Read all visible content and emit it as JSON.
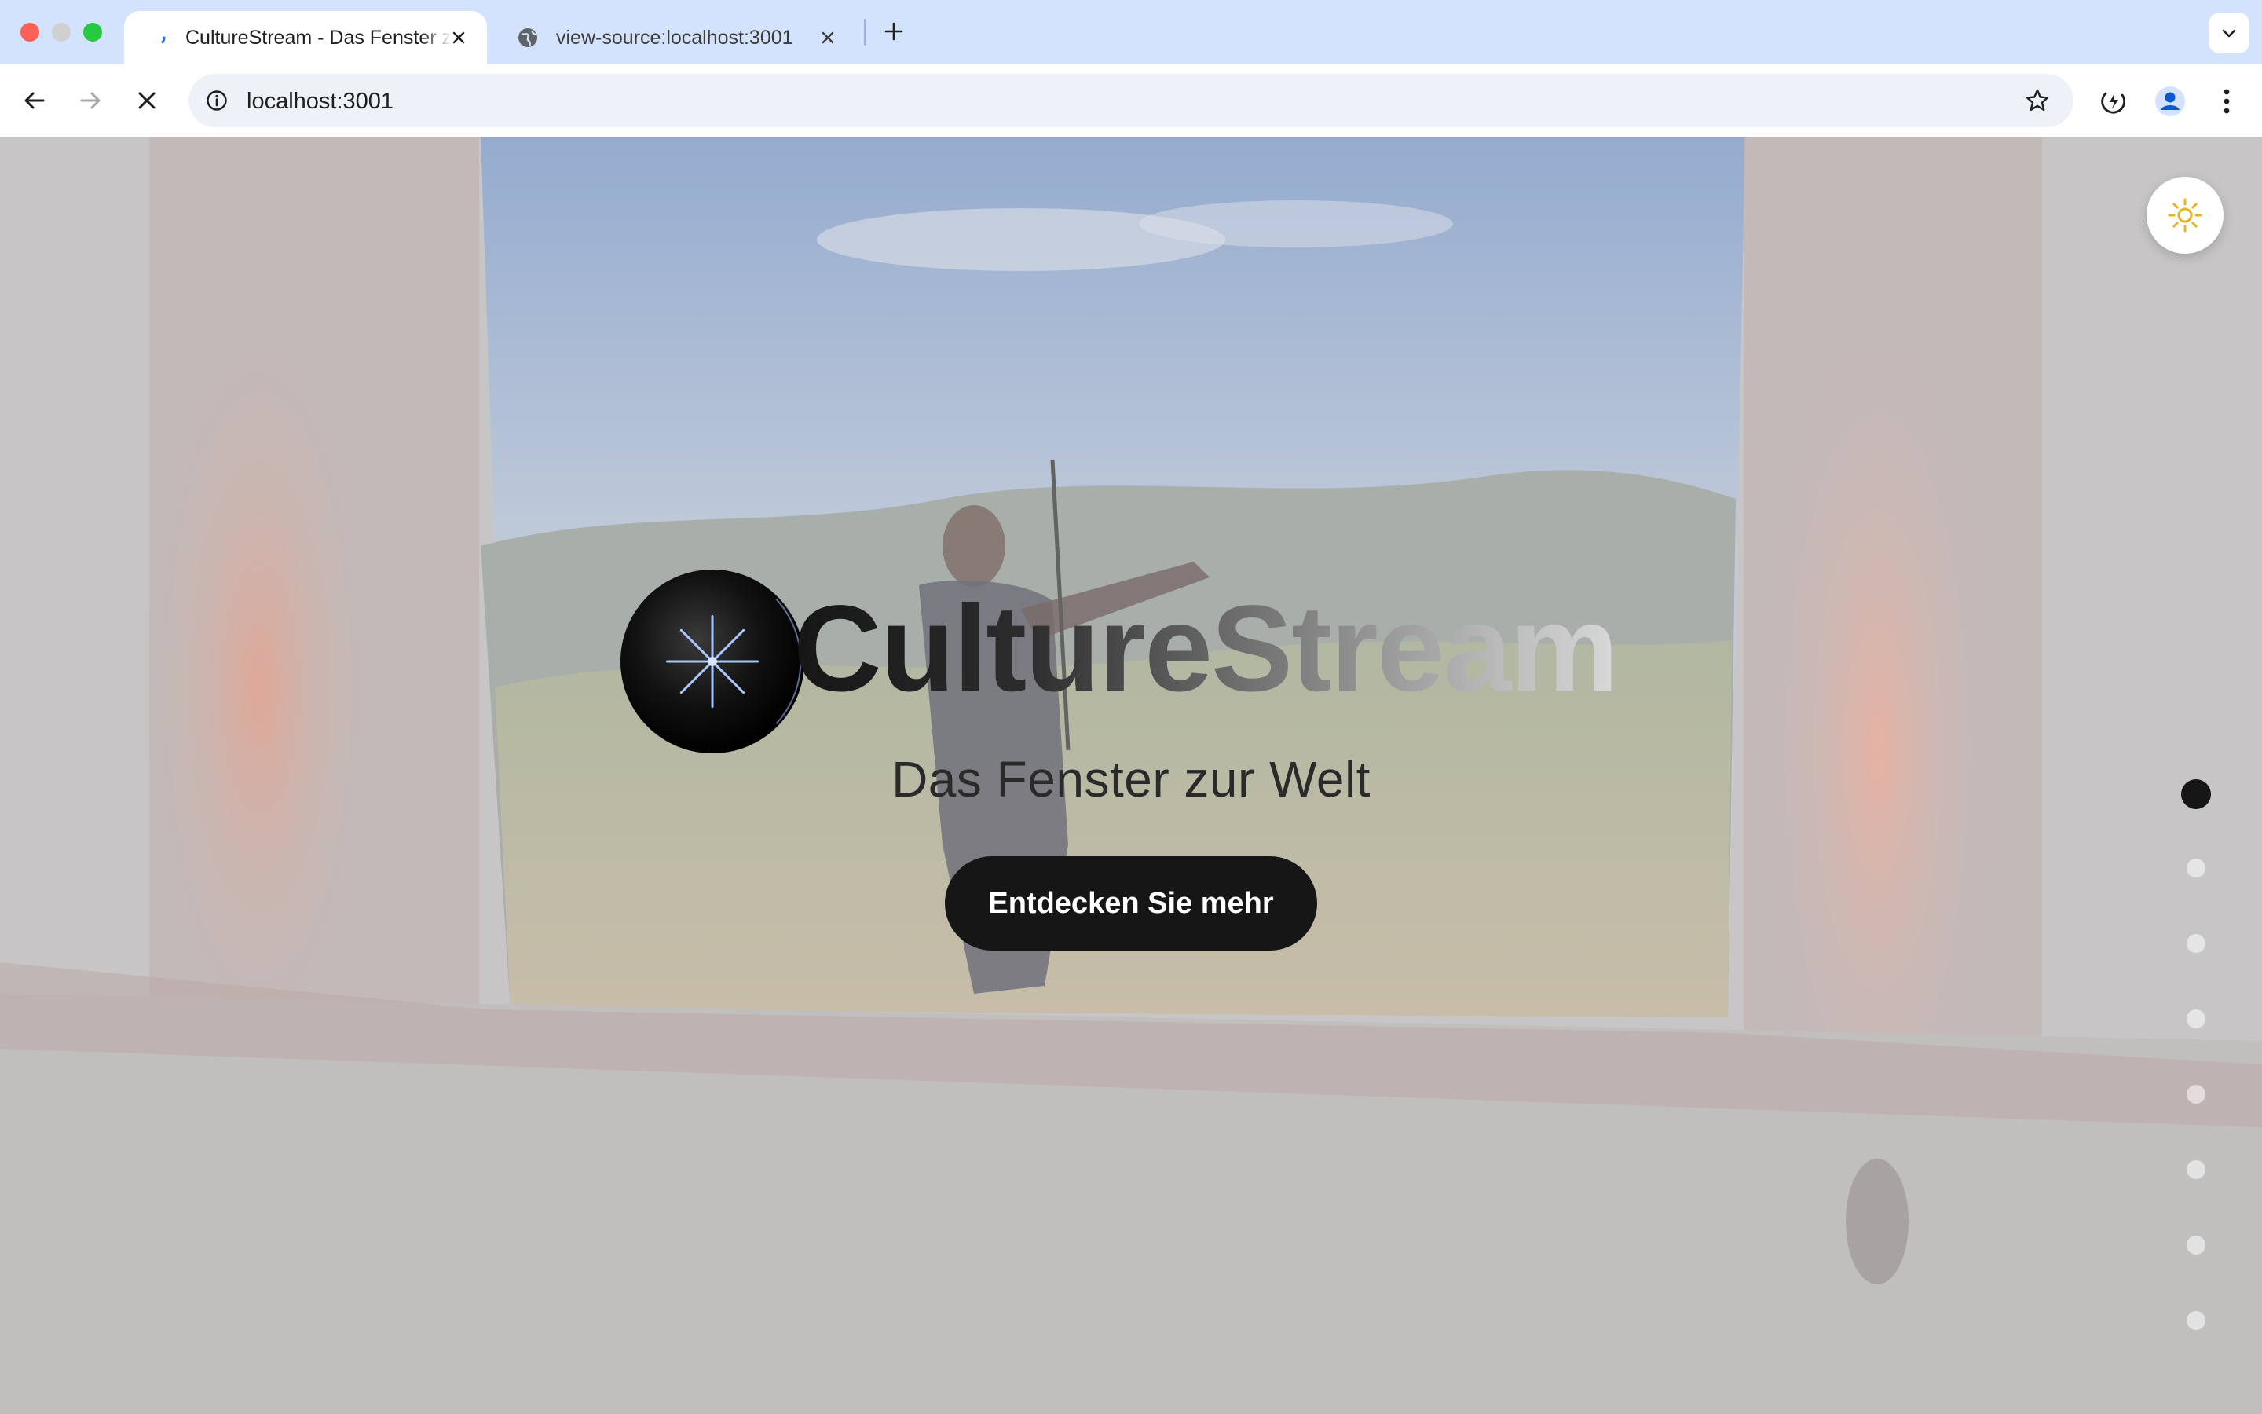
{
  "browser": {
    "tabs": [
      {
        "title": "CultureStream - Das Fenster zur Welt",
        "active": true
      },
      {
        "title": "view-source:localhost:3001",
        "active": false
      }
    ],
    "address": "localhost:3001"
  },
  "hero": {
    "brand": "CultureStream",
    "tagline": "Das Fenster zur Welt",
    "cta_label": "Entdecken Sie mehr"
  },
  "section_nav": {
    "count": 8,
    "active_index": 0
  },
  "icons": {
    "theme_toggle": "sun-icon",
    "logo": "sparkle-orb-logo"
  },
  "colors": {
    "cta_background": "#161616",
    "cta_text": "#ffffff",
    "sun": "#e7b321",
    "tabbar": "#d3e3fd"
  }
}
